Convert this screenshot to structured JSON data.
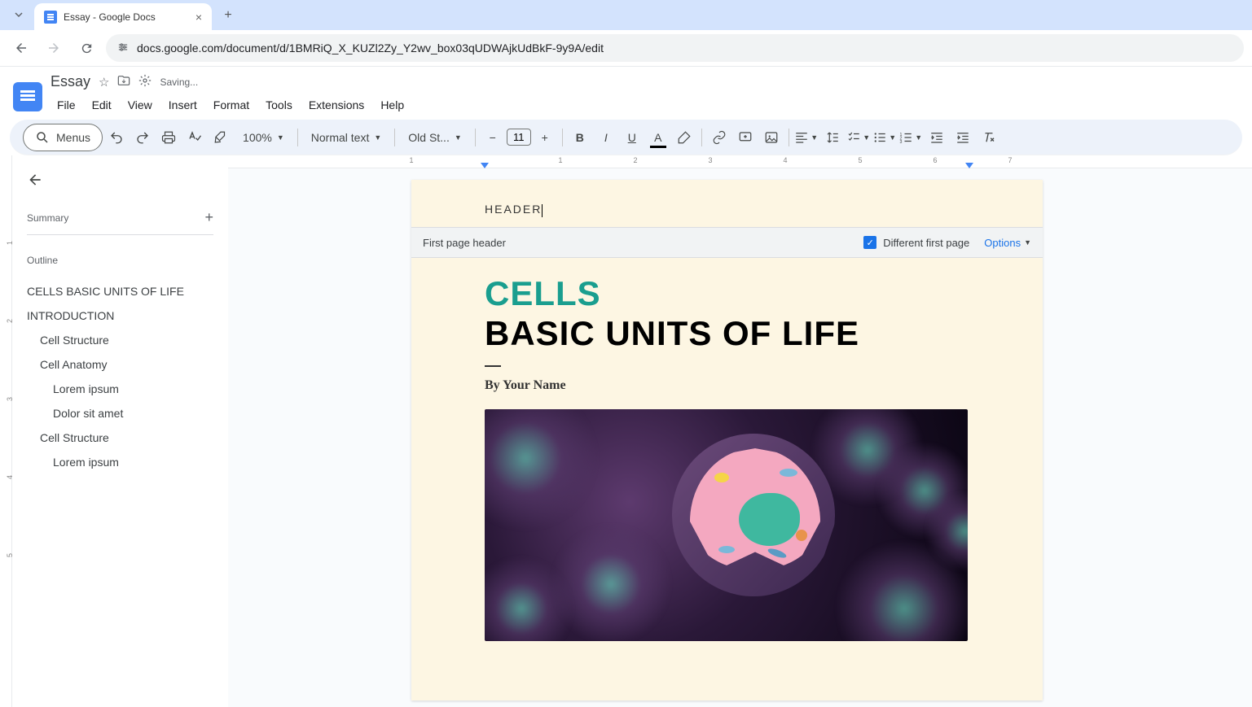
{
  "browser": {
    "tab_title": "Essay - Google Docs",
    "url": "docs.google.com/document/d/1BMRiQ_X_KUZl2Zy_Y2wv_box03qUDWAjkUdBkF-9y9A/edit"
  },
  "app": {
    "doc_title": "Essay",
    "saving_label": "Saving...",
    "menus": [
      "File",
      "Edit",
      "View",
      "Insert",
      "Format",
      "Tools",
      "Extensions",
      "Help"
    ]
  },
  "toolbar": {
    "menus_label": "Menus",
    "zoom": "100%",
    "style": "Normal text",
    "font": "Old St...",
    "font_size": "11"
  },
  "outline": {
    "summary_label": "Summary",
    "outline_label": "Outline",
    "items": [
      {
        "text": "CELLS BASIC UNITS OF LIFE",
        "level": "h1"
      },
      {
        "text": "INTRODUCTION",
        "level": "h1"
      },
      {
        "text": "Cell Structure",
        "level": "h2"
      },
      {
        "text": "Cell Anatomy",
        "level": "h2"
      },
      {
        "text": "Lorem ipsum",
        "level": "h3"
      },
      {
        "text": "Dolor sit amet",
        "level": "h3"
      },
      {
        "text": "Cell Structure",
        "level": "h2"
      },
      {
        "text": "Lorem ipsum",
        "level": "h3"
      }
    ]
  },
  "header_controls": {
    "label": "First page header",
    "checkbox_label": "Different first page",
    "options_label": "Options"
  },
  "document": {
    "header_text": "HEADER",
    "title_green": "CELLS",
    "title_black": "BASIC UNITS OF LIFE",
    "byline": "By Your Name"
  },
  "ruler": {
    "h_numbers": [
      "1",
      "1",
      "2",
      "3",
      "4",
      "5",
      "6",
      "7"
    ],
    "v_numbers": [
      "1",
      "2",
      "3",
      "4",
      "5"
    ]
  }
}
